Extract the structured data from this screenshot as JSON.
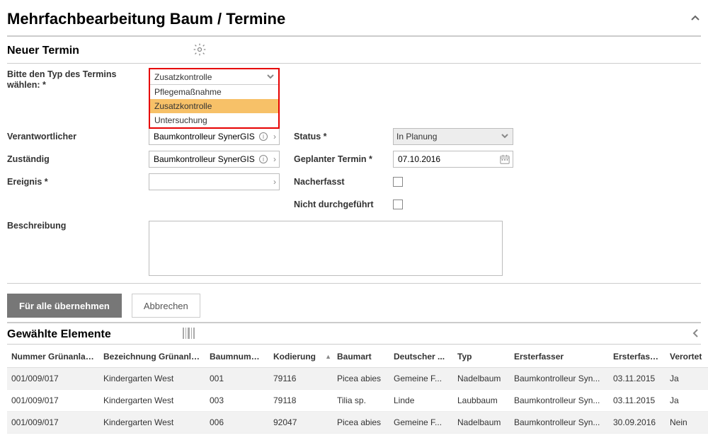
{
  "page": {
    "title": "Mehrfachbearbeitung Baum / Termine"
  },
  "section_new": {
    "title": "Neuer Termin",
    "type_label": "Bitte den Typ des Termins wählen: *",
    "type_selected": "Zusatzkontrolle",
    "type_options": [
      "Pflegemaßnahme",
      "Zusatzkontrolle",
      "Untersuchung"
    ],
    "highlighted_index": 1,
    "responsible_label": "Verantwortlicher",
    "responsible_value": "Baumkontrolleur SynerGIS",
    "assigned_label": "Zuständig",
    "assigned_value": "Baumkontrolleur SynerGIS",
    "event_label": "Ereignis *",
    "event_value": "",
    "status_label": "Status *",
    "status_value": "In Planung",
    "planned_label": "Geplanter Termin *",
    "planned_value": "07.10.2016",
    "afterrec_label": "Nacherfasst",
    "notdone_label": "Nicht durchgeführt",
    "desc_label": "Beschreibung",
    "desc_value": ""
  },
  "buttons": {
    "apply_all": "Für alle übernehmen",
    "cancel": "Abbrechen"
  },
  "section_sel": {
    "title": "Gewählte Elemente"
  },
  "grid": {
    "columns": [
      "Nummer Grünanlage",
      "Bezeichnung Grünanlage",
      "Baumnummer",
      "Kodierung",
      "Baumart",
      "Deutscher ...",
      "Typ",
      "Ersterfasser",
      "Ersterfass...",
      "Verortet"
    ],
    "col_widths": [
      "130",
      "150",
      "90",
      "90",
      "80",
      "90",
      "80",
      "140",
      "80",
      "60"
    ],
    "sort_col": 3,
    "rows": [
      [
        "001/009/017",
        "Kindergarten West",
        "001",
        "79116",
        "Picea abies",
        "Gemeine F...",
        "Nadelbaum",
        "Baumkontrolleur Syn...",
        "03.11.2015",
        "Ja"
      ],
      [
        "001/009/017",
        "Kindergarten West",
        "003",
        "79118",
        "Tilia sp.",
        "Linde",
        "Laubbaum",
        "Baumkontrolleur Syn...",
        "03.11.2015",
        "Ja"
      ],
      [
        "001/009/017",
        "Kindergarten West",
        "006",
        "92047",
        "Picea abies",
        "Gemeine F...",
        "Nadelbaum",
        "Baumkontrolleur Syn...",
        "30.09.2016",
        "Nein"
      ]
    ]
  }
}
